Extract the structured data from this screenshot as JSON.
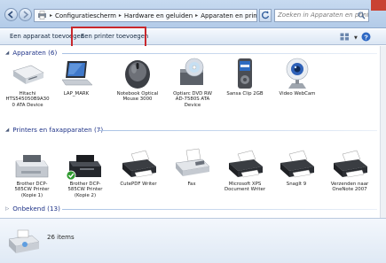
{
  "address": {
    "crumbs": [
      "Configuratiescherm",
      "Hardware en geluiden",
      "Apparaten en printers"
    ],
    "search_placeholder": "Zoeken in Apparaten en printers"
  },
  "toolbar": {
    "add_device": "Een apparaat toevoegen",
    "add_printer": "Een printer toevoegen"
  },
  "groups": {
    "devices": {
      "title": "Apparaten (6)",
      "items": [
        {
          "label": "Hitachi HTS545050B9A30 0 ATA Device",
          "icon": "hard-drive-icon"
        },
        {
          "label": "LAP_MARK",
          "icon": "laptop-icon"
        },
        {
          "label": "Notebook Optical Mouse 3000",
          "icon": "mouse-icon"
        },
        {
          "label": "Optiarc DVD RW AD-7580S ATA Device",
          "icon": "dvd-drive-icon"
        },
        {
          "label": "Sansa Clip 2GB",
          "icon": "mp3-player-icon"
        },
        {
          "label": "Video WebCam",
          "icon": "webcam-icon"
        }
      ]
    },
    "printers": {
      "title": "Printers en faxapparaten (7)",
      "items": [
        {
          "label": "Brother DCP-585CW Printer (Kopie 1)",
          "icon": "printer-icon"
        },
        {
          "label": "Brother DCP-585CW Printer (Kopie 2)",
          "icon": "printer-default-icon"
        },
        {
          "label": "CutePDF Writer",
          "icon": "printer-icon"
        },
        {
          "label": "Fax",
          "icon": "fax-icon"
        },
        {
          "label": "Microsoft XPS Document Writer",
          "icon": "printer-icon"
        },
        {
          "label": "SnagIt 9",
          "icon": "printer-icon"
        },
        {
          "label": "Verzenden naar OneNote 2007",
          "icon": "printer-icon"
        }
      ]
    },
    "unknown": {
      "title": "Onbekend (13)"
    }
  },
  "details": {
    "count": "26 items"
  },
  "colors": {
    "group_header": "#1e3287",
    "highlight": "#c8282d",
    "default_check": "#2f9a2f"
  }
}
